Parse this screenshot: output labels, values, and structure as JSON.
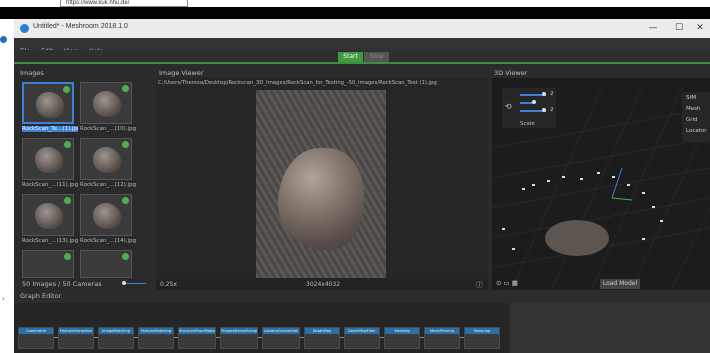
{
  "browser": {
    "url": "https://www.kuk.hhu.de/"
  },
  "window": {
    "title": "Untitled* - Meshroom 2018.1.0",
    "controls": {
      "minimize": "—",
      "maximize": "☐",
      "close": "✕"
    }
  },
  "menu": {
    "items": [
      "File",
      "Edit",
      "View",
      "Help"
    ]
  },
  "actions": {
    "start": "Start",
    "stop": "Stop"
  },
  "images_panel": {
    "title": "Images",
    "thumbnails": [
      {
        "label": "RockScan_Te...(1).jpg",
        "selected": true
      },
      {
        "label": "RockScan_...(10).jpg",
        "selected": false
      },
      {
        "label": "RockScan_...(11).jpg",
        "selected": false
      },
      {
        "label": "RockScan_...(12).jpg",
        "selected": false
      },
      {
        "label": "RockScan_...(13).jpg",
        "selected": false
      },
      {
        "label": "RockScan_...(14).jpg",
        "selected": false
      }
    ],
    "footer": "50 Images / 50 Cameras"
  },
  "image_viewer": {
    "title": "Image Viewer",
    "path": "C:/Users/Theresa/Desktop/Rockscan_3D_Images/RockScan_for_Testing_-50_Images/RockScan_Test (1).jpg",
    "zoom": "0.25x",
    "resolution": "3024x4032"
  },
  "viewer_3d": {
    "title": "3D Viewer",
    "control_values": {
      "a": "2",
      "b": "2"
    },
    "scale_label": "Scale",
    "legend": [
      "SfM",
      "Mesh",
      "Grid",
      "Locator"
    ],
    "load_model": "Load Model"
  },
  "graph_editor": {
    "title": "Graph Editor",
    "nodes": [
      "CameraInit",
      "FeatureExtraction",
      "ImageMatching",
      "FeatureMatching",
      "StructureFromMotion",
      "PrepareDenseScene",
      "CameraConnection",
      "DepthMap",
      "DepthMapFilter",
      "Meshing",
      "MeshFiltering",
      "Texturing"
    ]
  },
  "colors": {
    "accent": "#3d7fd6",
    "start": "#3e9b41",
    "node_header": "#2a6fa5",
    "background": "#2b2b2b"
  }
}
